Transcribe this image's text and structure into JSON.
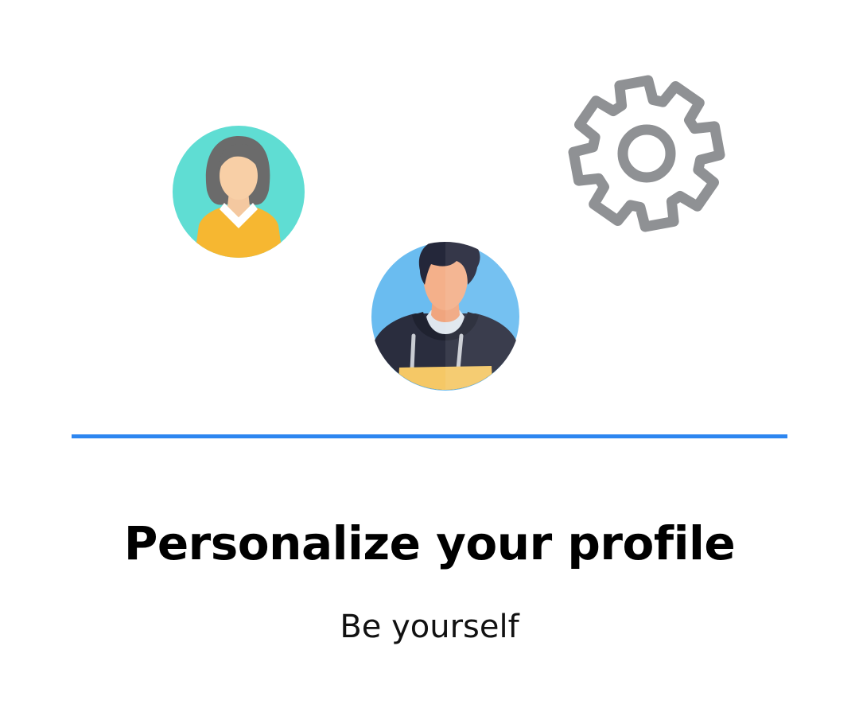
{
  "onboarding": {
    "title": "Personalize your profile",
    "subtitle": "Be yourself"
  },
  "illustration": {
    "icons": [
      "woman-avatar-icon",
      "man-avatar-icon",
      "gear-icon"
    ]
  },
  "colors": {
    "divider": "#2d86f0",
    "woman_avatar_bg": "#5fddd3",
    "man_avatar_bg": "#6abcf0",
    "gear": "#8f9194"
  }
}
